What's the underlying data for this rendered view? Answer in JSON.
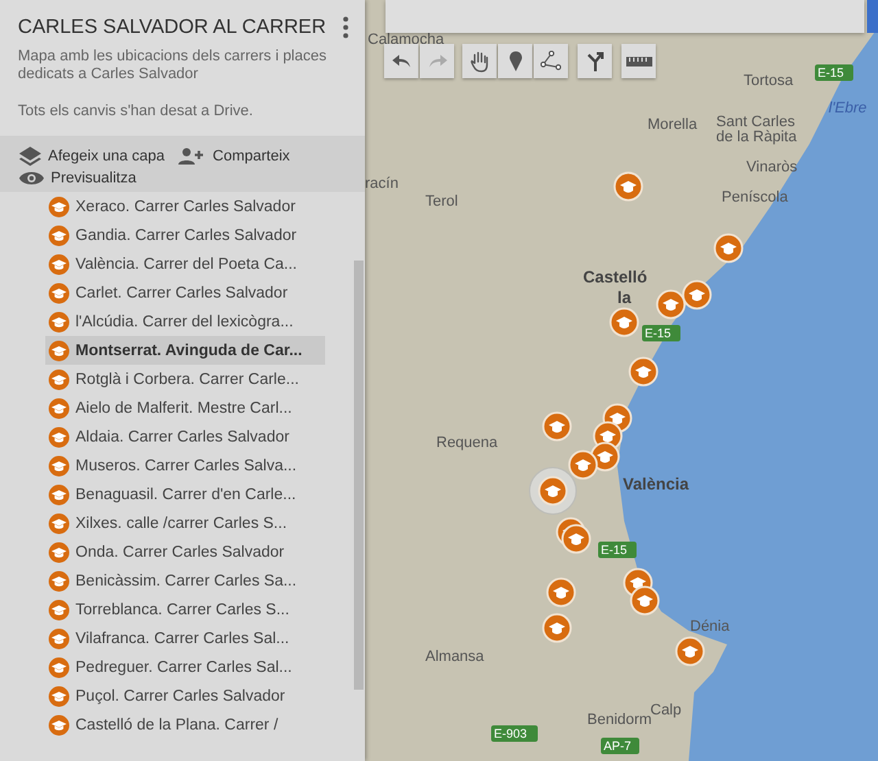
{
  "sidebar": {
    "title": "CARLES SALVADOR AL CARRER",
    "description": "Mapa amb les ubicacions dels carrers i places dedicats a Carles Salvador",
    "save_status": "Tots els canvis s'han desat a Drive.",
    "actions": [
      {
        "kind": "layer",
        "label": "Afegeix una capa"
      },
      {
        "kind": "share",
        "label": "Comparteix"
      },
      {
        "kind": "preview",
        "label": "Previsualitza"
      }
    ],
    "items": [
      {
        "label": "Xeraco. Carrer Carles Salvador",
        "selected": false
      },
      {
        "label": "Gandia. Carrer Carles Salvador",
        "selected": false
      },
      {
        "label": "València. Carrer del Poeta Ca...",
        "selected": false
      },
      {
        "label": "Carlet. Carrer Carles Salvador",
        "selected": false
      },
      {
        "label": "l'Alcúdia. Carrer del lexicògra...",
        "selected": false
      },
      {
        "label": "Montserrat. Avinguda de Car...",
        "selected": true
      },
      {
        "label": "Rotglà i Corbera. Carrer Carle...",
        "selected": false
      },
      {
        "label": "Aielo de Malferit. Mestre Carl...",
        "selected": false
      },
      {
        "label": "Aldaia. Carrer Carles Salvador",
        "selected": false
      },
      {
        "label": "Museros. Carrer Carles Salva...",
        "selected": false
      },
      {
        "label": "Benaguasil. Carrer d'en Carle...",
        "selected": false
      },
      {
        "label": "Xilxes. calle /carrer Carles S...",
        "selected": false
      },
      {
        "label": "Onda. Carrer Carles Salvador",
        "selected": false
      },
      {
        "label": "Benicàssim. Carrer Carles Sa...",
        "selected": false
      },
      {
        "label": "Torreblanca. Carrer Carles S...",
        "selected": false
      },
      {
        "label": "Vilafranca. Carrer Carles Sal...",
        "selected": false
      },
      {
        "label": "Pedreguer. Carrer Carles Sal...",
        "selected": false
      },
      {
        "label": "Puçol. Carrer Carles Salvador",
        "selected": false
      },
      {
        "label": "Castelló de la Plana. Carrer /",
        "selected": false
      }
    ]
  },
  "map": {
    "tools": [
      {
        "kind": "undo"
      },
      {
        "kind": "redo"
      },
      {
        "kind": "hand"
      },
      {
        "kind": "marker"
      },
      {
        "kind": "line"
      },
      {
        "kind": "directions"
      },
      {
        "kind": "ruler"
      }
    ],
    "labels": [
      {
        "kind": "town",
        "text": "Calamocha"
      },
      {
        "kind": "town",
        "text": "Tortosa"
      },
      {
        "kind": "road",
        "text": "E-15"
      },
      {
        "kind": "river",
        "text": "l'Ebre"
      },
      {
        "kind": "town",
        "text": "Morella"
      },
      {
        "kind": "town",
        "text": "Sant Carles"
      },
      {
        "kind": "town",
        "text": "de la Ràpita"
      },
      {
        "kind": "town",
        "text": "Vinaròs"
      },
      {
        "kind": "town",
        "text": "racín"
      },
      {
        "kind": "town",
        "text": "Terol"
      },
      {
        "kind": "town",
        "text": "Peníscola"
      },
      {
        "kind": "city",
        "text": "Castelló"
      },
      {
        "kind": "city",
        "text": "la"
      },
      {
        "kind": "road",
        "text": "E-15"
      },
      {
        "kind": "town",
        "text": "Requena"
      },
      {
        "kind": "city",
        "text": "València"
      },
      {
        "kind": "road",
        "text": "E-15"
      },
      {
        "kind": "town",
        "text": "Almansa"
      },
      {
        "kind": "town",
        "text": "Dénia"
      },
      {
        "kind": "town",
        "text": "Calp"
      },
      {
        "kind": "town",
        "text": "Benidorm"
      },
      {
        "kind": "road",
        "text": "E-903"
      },
      {
        "kind": "road",
        "text": "AP-7"
      }
    ],
    "markers": [
      {
        "selected": false
      },
      {
        "selected": false
      },
      {
        "selected": false
      },
      {
        "selected": false
      },
      {
        "selected": false
      },
      {
        "selected": false
      },
      {
        "selected": false
      },
      {
        "selected": false
      },
      {
        "selected": false
      },
      {
        "selected": false
      },
      {
        "selected": false
      },
      {
        "selected": true
      },
      {
        "selected": false
      },
      {
        "selected": false
      },
      {
        "selected": false
      },
      {
        "selected": false
      },
      {
        "selected": false
      },
      {
        "selected": false
      },
      {
        "selected": false
      }
    ]
  }
}
